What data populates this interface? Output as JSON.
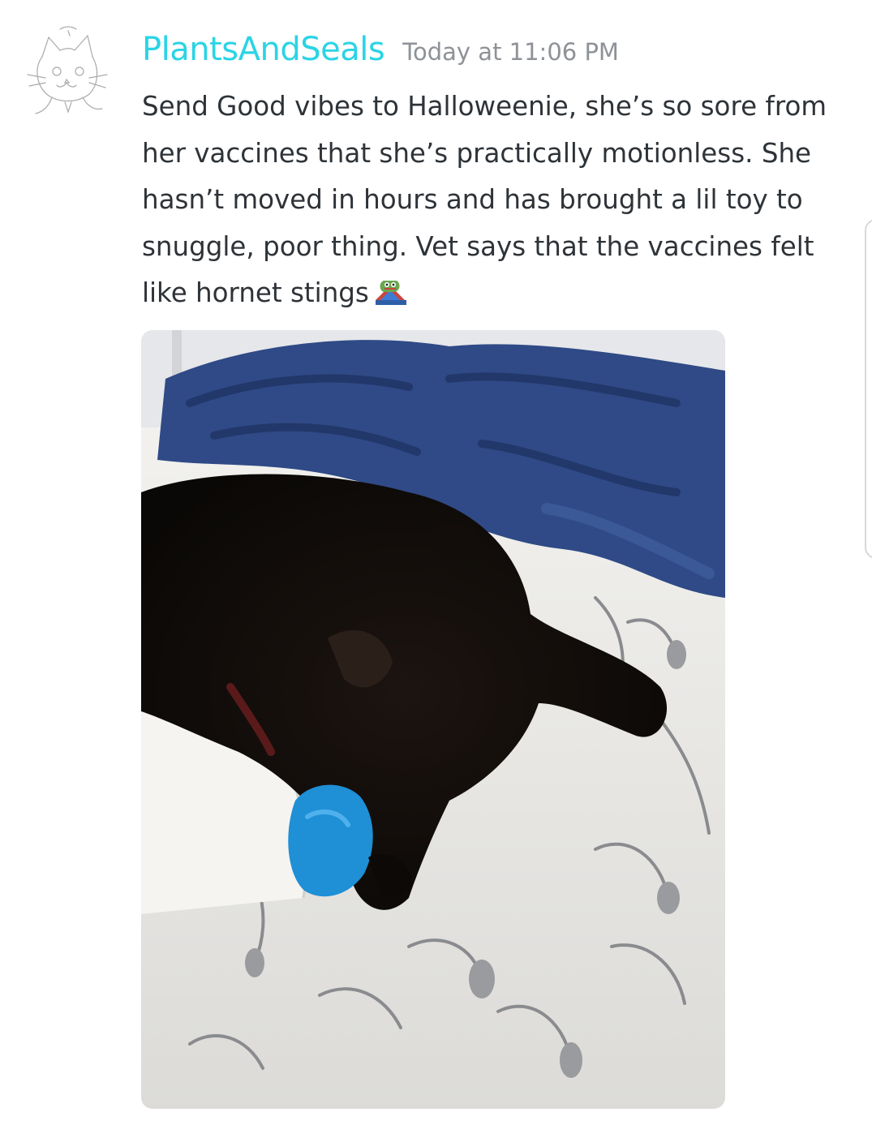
{
  "message": {
    "author": "PlantsAndSeals",
    "author_color": "#2ad4e5",
    "timestamp": "Today at 11:06 PM",
    "text": "Send Good vibes to Halloweenie, she’s so sore from her vaccines that she’s practically motionless. She hasn’t moved in hours and has brought a lil toy to snuggle, poor thing. Vet says that the vaccines felt like hornet stings",
    "emoji": "pepe-emoji",
    "avatar_icon": "cat-sketch-avatar-icon",
    "attachment_icon": "cat-photo-image"
  }
}
